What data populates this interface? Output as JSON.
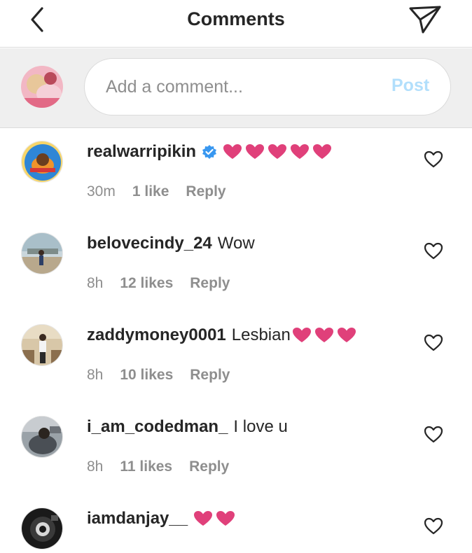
{
  "header": {
    "title": "Comments"
  },
  "compose": {
    "placeholder": "Add a comment...",
    "post_label": "Post"
  },
  "comments": [
    {
      "username": "realwarripikin",
      "text": "",
      "verified": true,
      "hearts": 5,
      "time": "30m",
      "likes": "1 like",
      "reply": "Reply"
    },
    {
      "username": "belovecindy_24",
      "text": "Wow",
      "verified": false,
      "hearts": 0,
      "time": "8h",
      "likes": "12 likes",
      "reply": "Reply"
    },
    {
      "username": "zaddymoney0001",
      "text": "Lesbian",
      "verified": false,
      "hearts": 3,
      "time": "8h",
      "likes": "10 likes",
      "reply": "Reply"
    },
    {
      "username": "i_am_codedman_",
      "text": "I love u",
      "verified": false,
      "hearts": 0,
      "time": "8h",
      "likes": "11 likes",
      "reply": "Reply"
    },
    {
      "username": "iamdanjay__",
      "text": "",
      "verified": false,
      "hearts": 2,
      "time": "",
      "likes": "",
      "reply": ""
    }
  ],
  "colors": {
    "heart": "#e0407a",
    "verified": "#3897f0",
    "post_disabled": "#b2dffc",
    "meta": "#8e8e8e"
  },
  "icons": {
    "back": "chevron-left-icon",
    "send": "paper-plane-icon",
    "like": "heart-outline-icon",
    "emoji": "pink-heart-emoji"
  }
}
